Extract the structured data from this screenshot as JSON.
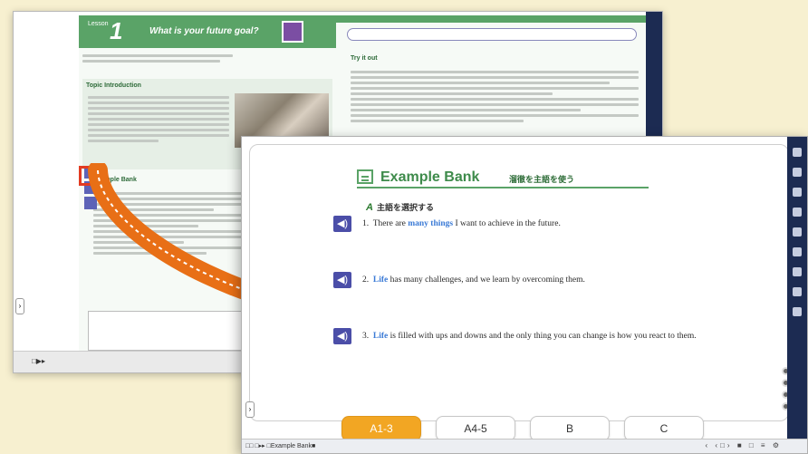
{
  "back_window": {
    "lesson_label": "Lesson",
    "lesson_number": "1",
    "lesson_title": "What is your future goal?",
    "topic_title": "Topic Introduction",
    "try_title": "Try it out",
    "eb_mini_title": "Example Bank",
    "bottom_label": "□▶▸"
  },
  "front_window": {
    "example_bank_title": "Example Bank",
    "example_bank_subtitle": "溜徹を主語を使う",
    "section_letter": "A",
    "section_label": "主語を選択する",
    "speaker_glyph": "◀)",
    "examples": [
      {
        "num": "1.",
        "pre": "There are ",
        "hl": "many things",
        "post": " I want to achieve in the future."
      },
      {
        "num": "2.",
        "pre": "",
        "hl": "Life",
        "post": " has many challenges, and we learn by overcoming them."
      },
      {
        "num": "3.",
        "pre": "",
        "hl": "Life",
        "post": " is filled with ups and downs and the only thing you can change is how you react to them."
      }
    ],
    "tabs": [
      "A1-3",
      "A4-5",
      "B",
      "C"
    ],
    "active_tab": "A1-3",
    "status_left": "□□ □▸▸ □Example Bank■",
    "status_right": "‹ ‹□› ■ □ ≡ ⚙"
  },
  "colors": {
    "accent_green": "#5aa367",
    "speaker_purple": "#4b4ea8",
    "tab_active": "#f2a623",
    "highlight_blue": "#3a7ad6",
    "arrow_orange": "#e86f16",
    "rail_navy": "#1c2b52"
  }
}
